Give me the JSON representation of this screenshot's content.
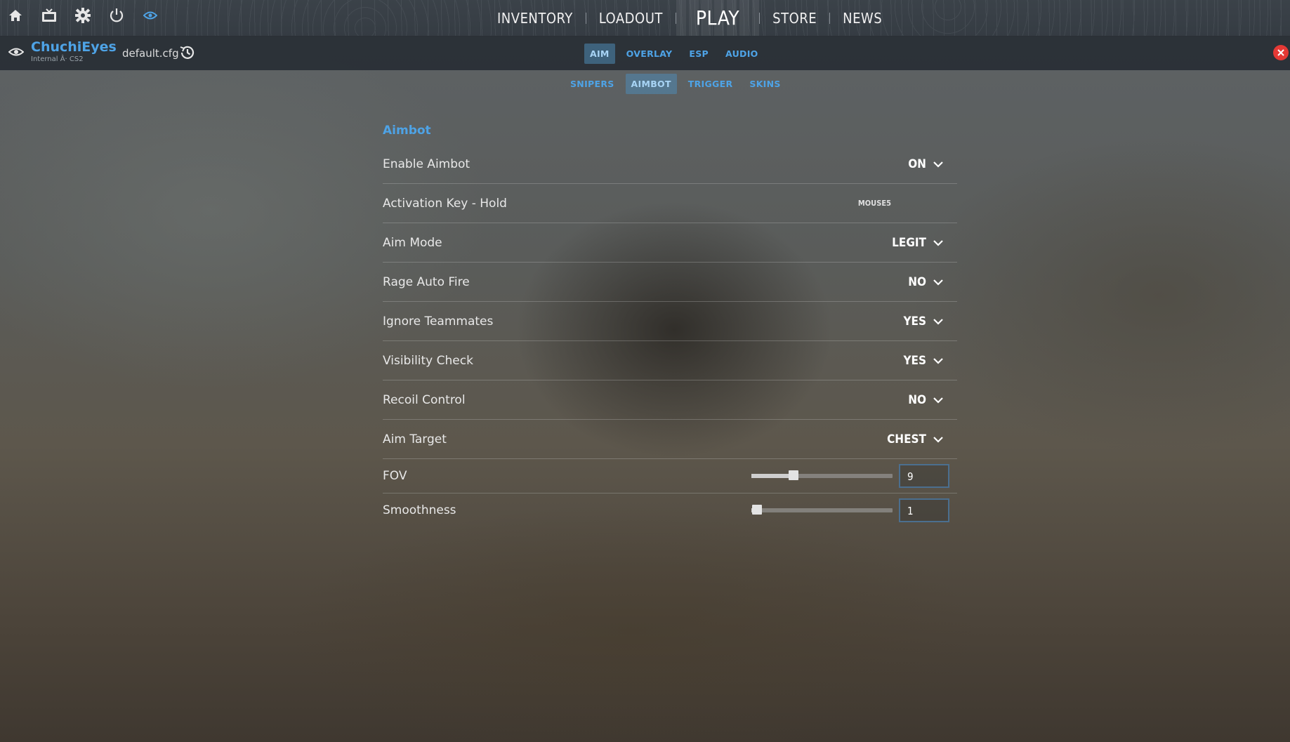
{
  "topbar": {
    "icons": [
      "home-icon",
      "tv-icon",
      "settings-gear-icon",
      "power-icon",
      "eye-icon"
    ],
    "nav": [
      "INVENTORY",
      "LOADOUT",
      "PLAY",
      "STORE",
      "NEWS"
    ]
  },
  "brand": {
    "name": "ChuchiEyes",
    "subtitle": "Internal Â· CS2",
    "config_file": "default.cfg"
  },
  "primary_tabs": [
    "AIM",
    "OVERLAY",
    "ESP",
    "AUDIO"
  ],
  "primary_active": "AIM",
  "secondary_tabs": [
    "SNIPERS",
    "AIMBOT",
    "TRIGGER",
    "SKINS"
  ],
  "secondary_active": "AIMBOT",
  "section": {
    "title": "Aimbot",
    "rows": [
      {
        "label": "Enable Aimbot",
        "value": "ON"
      },
      {
        "label": "Activation Key - Hold",
        "value": "MOUSE5"
      },
      {
        "label": "Aim Mode",
        "value": "LEGIT"
      },
      {
        "label": "Rage Auto Fire",
        "value": "NO"
      },
      {
        "label": "Ignore Teammates",
        "value": "YES"
      },
      {
        "label": "Visibility Check",
        "value": "YES"
      },
      {
        "label": "Recoil Control",
        "value": "NO"
      },
      {
        "label": "Aim Target",
        "value": "CHEST"
      }
    ],
    "sliders": [
      {
        "label": "FOV",
        "value": "9",
        "fraction": 0.3
      },
      {
        "label": "Smoothness",
        "value": "1",
        "fraction": 0.04
      }
    ]
  },
  "colors": {
    "accent": "#4ea3e6",
    "close": "#e53935"
  }
}
